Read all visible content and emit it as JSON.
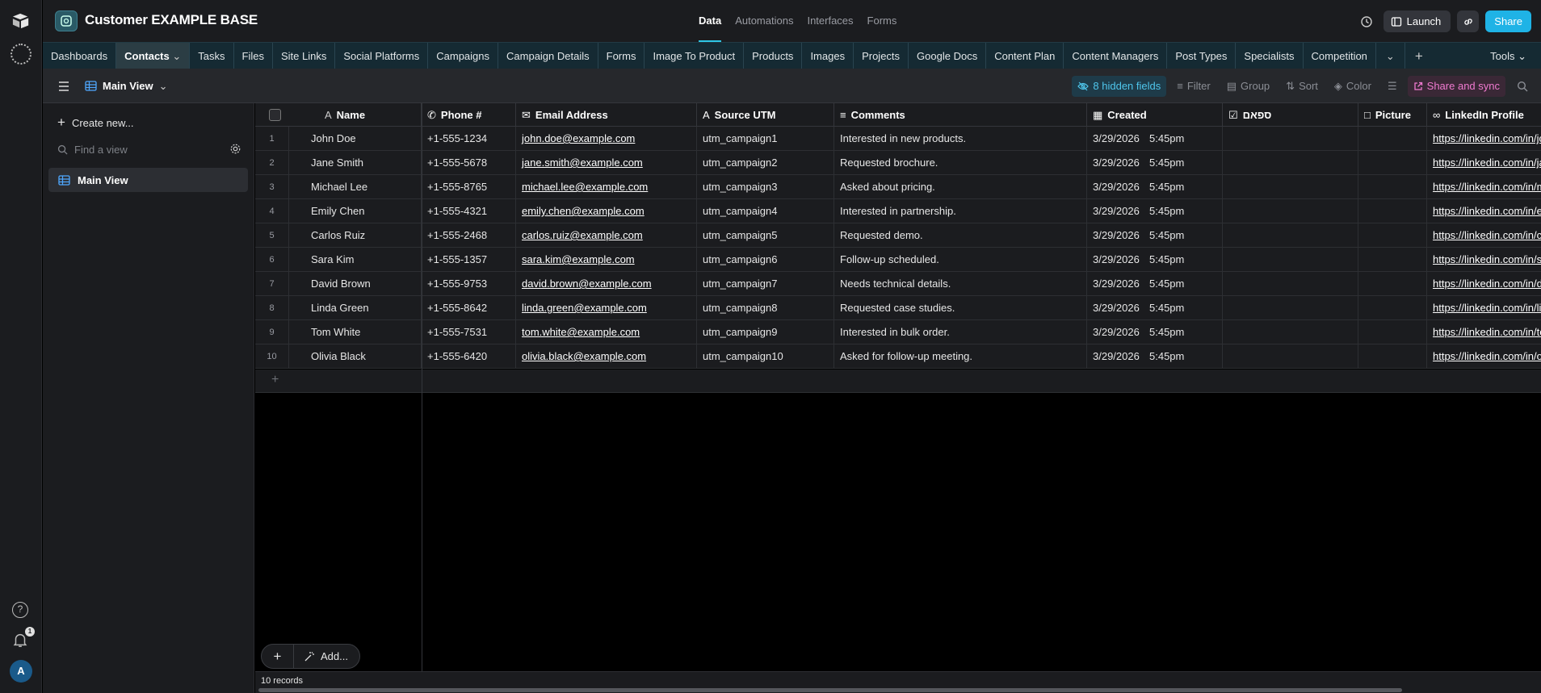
{
  "base": {
    "title": "Customer EXAMPLE BASE"
  },
  "topnav": [
    "Data",
    "Automations",
    "Interfaces",
    "Forms"
  ],
  "header": {
    "launch_label": "Launch",
    "share_label": "Share"
  },
  "tabs": [
    "Dashboards",
    "Contacts",
    "Tasks",
    "Files",
    "Site Links",
    "Social Platforms",
    "Campaigns",
    "Campaign Details",
    "Forms",
    "Image To Product",
    "Products",
    "Images",
    "Projects",
    "Google Docs",
    "Content Plan",
    "Content Managers",
    "Post Types",
    "Specialists",
    "Competition"
  ],
  "tools_label": "Tools",
  "toolbar": {
    "view_name": "Main View",
    "hidden_fields": "8 hidden fields",
    "filter": "Filter",
    "group": "Group",
    "sort": "Sort",
    "color": "Color",
    "share_sync": "Share and sync"
  },
  "sidebar": {
    "create_new": "Create new...",
    "find_placeholder": "Find a view",
    "views": [
      "Main View"
    ]
  },
  "columns": [
    "Name",
    "Phone #",
    "Email Address",
    "Source UTM",
    "Comments",
    "Created",
    "ספאם",
    "Picture",
    "LinkedIn Profile"
  ],
  "rows": [
    {
      "n": "1",
      "name": "John Doe",
      "phone": "+1-555-1234",
      "email": "john.doe@example.com",
      "utm": "utm_campaign1",
      "comment": "Interested in new products.",
      "date": "3/29/2026",
      "time": "5:45pm",
      "linkedin": "https://linkedin.com/in/johndoe"
    },
    {
      "n": "2",
      "name": "Jane Smith",
      "phone": "+1-555-5678",
      "email": "jane.smith@example.com",
      "utm": "utm_campaign2",
      "comment": "Requested brochure.",
      "date": "3/29/2026",
      "time": "5:45pm",
      "linkedin": "https://linkedin.com/in/janesmith"
    },
    {
      "n": "3",
      "name": "Michael Lee",
      "phone": "+1-555-8765",
      "email": "michael.lee@example.com",
      "utm": "utm_campaign3",
      "comment": "Asked about pricing.",
      "date": "3/29/2026",
      "time": "5:45pm",
      "linkedin": "https://linkedin.com/in/michaellee"
    },
    {
      "n": "4",
      "name": "Emily Chen",
      "phone": "+1-555-4321",
      "email": "emily.chen@example.com",
      "utm": "utm_campaign4",
      "comment": "Interested in partnership.",
      "date": "3/29/2026",
      "time": "5:45pm",
      "linkedin": "https://linkedin.com/in/emilychen"
    },
    {
      "n": "5",
      "name": "Carlos Ruiz",
      "phone": "+1-555-2468",
      "email": "carlos.ruiz@example.com",
      "utm": "utm_campaign5",
      "comment": "Requested demo.",
      "date": "3/29/2026",
      "time": "5:45pm",
      "linkedin": "https://linkedin.com/in/carlosruiz"
    },
    {
      "n": "6",
      "name": "Sara Kim",
      "phone": "+1-555-1357",
      "email": "sara.kim@example.com",
      "utm": "utm_campaign6",
      "comment": "Follow-up scheduled.",
      "date": "3/29/2026",
      "time": "5:45pm",
      "linkedin": "https://linkedin.com/in/sarakim"
    },
    {
      "n": "7",
      "name": "David Brown",
      "phone": "+1-555-9753",
      "email": "david.brown@example.com",
      "utm": "utm_campaign7",
      "comment": "Needs technical details.",
      "date": "3/29/2026",
      "time": "5:45pm",
      "linkedin": "https://linkedin.com/in/davidbrown"
    },
    {
      "n": "8",
      "name": "Linda Green",
      "phone": "+1-555-8642",
      "email": "linda.green@example.com",
      "utm": "utm_campaign8",
      "comment": "Requested case studies.",
      "date": "3/29/2026",
      "time": "5:45pm",
      "linkedin": "https://linkedin.com/in/lindagreen"
    },
    {
      "n": "9",
      "name": "Tom White",
      "phone": "+1-555-7531",
      "email": "tom.white@example.com",
      "utm": "utm_campaign9",
      "comment": "Interested in bulk order.",
      "date": "3/29/2026",
      "time": "5:45pm",
      "linkedin": "https://linkedin.com/in/tomwhite"
    },
    {
      "n": "10",
      "name": "Olivia Black",
      "phone": "+1-555-6420",
      "email": "olivia.black@example.com",
      "utm": "utm_campaign10",
      "comment": "Asked for follow-up meeting.",
      "date": "3/29/2026",
      "time": "5:45pm",
      "linkedin": "https://linkedin.com/in/oliviablack"
    }
  ],
  "footer": {
    "add_label": "Add...",
    "record_count": "10 records"
  },
  "user": {
    "avatar_initial": "A"
  },
  "notifications": {
    "badge": "1"
  },
  "colors": {
    "accent": "#1fb3e6",
    "hidden_fields": "#4fc6ec",
    "share_sync": "#f07ad0"
  }
}
